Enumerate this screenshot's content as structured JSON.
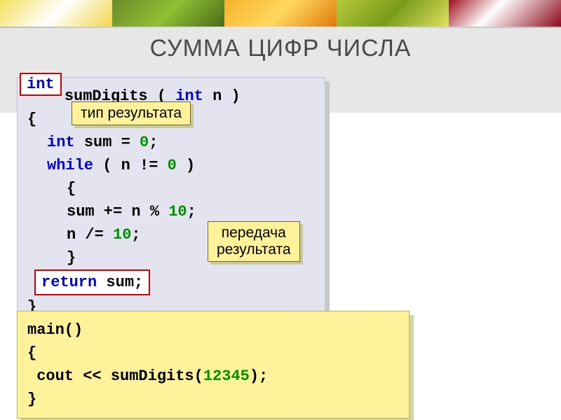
{
  "title": "СУММА ЦИФР ЧИСЛА",
  "intCallout": "int",
  "labels": {
    "type": "тип результата",
    "return_l1": "передача",
    "return_l2": "результата"
  },
  "code1": {
    "l1": {
      "t1": "sumDigits ( ",
      "kw": "int",
      "t2": "n )"
    },
    "l2": "{",
    "l3": {
      "kw": "int",
      "t1": "sum",
      "op": "=",
      "num": "0",
      "t2": ";"
    },
    "l4": {
      "kw": "while",
      "t1": "( n !=",
      "num": "0",
      "t2": ")"
    },
    "l5": "{",
    "l6": {
      "t1": "sum += n %",
      "num": "10",
      "t2": ";"
    },
    "l7": {
      "t1": "n /=",
      "num": "10",
      "t2": ";"
    },
    "l8": "}",
    "l9": {
      "kw": "return",
      "t1": "sum;"
    },
    "l10": "}"
  },
  "code2": {
    "l1": "main()",
    "l2": "{",
    "l3": {
      "t1": " cout << sumDigits(",
      "num": "12345",
      "t2": ");"
    },
    "l4": "}"
  }
}
